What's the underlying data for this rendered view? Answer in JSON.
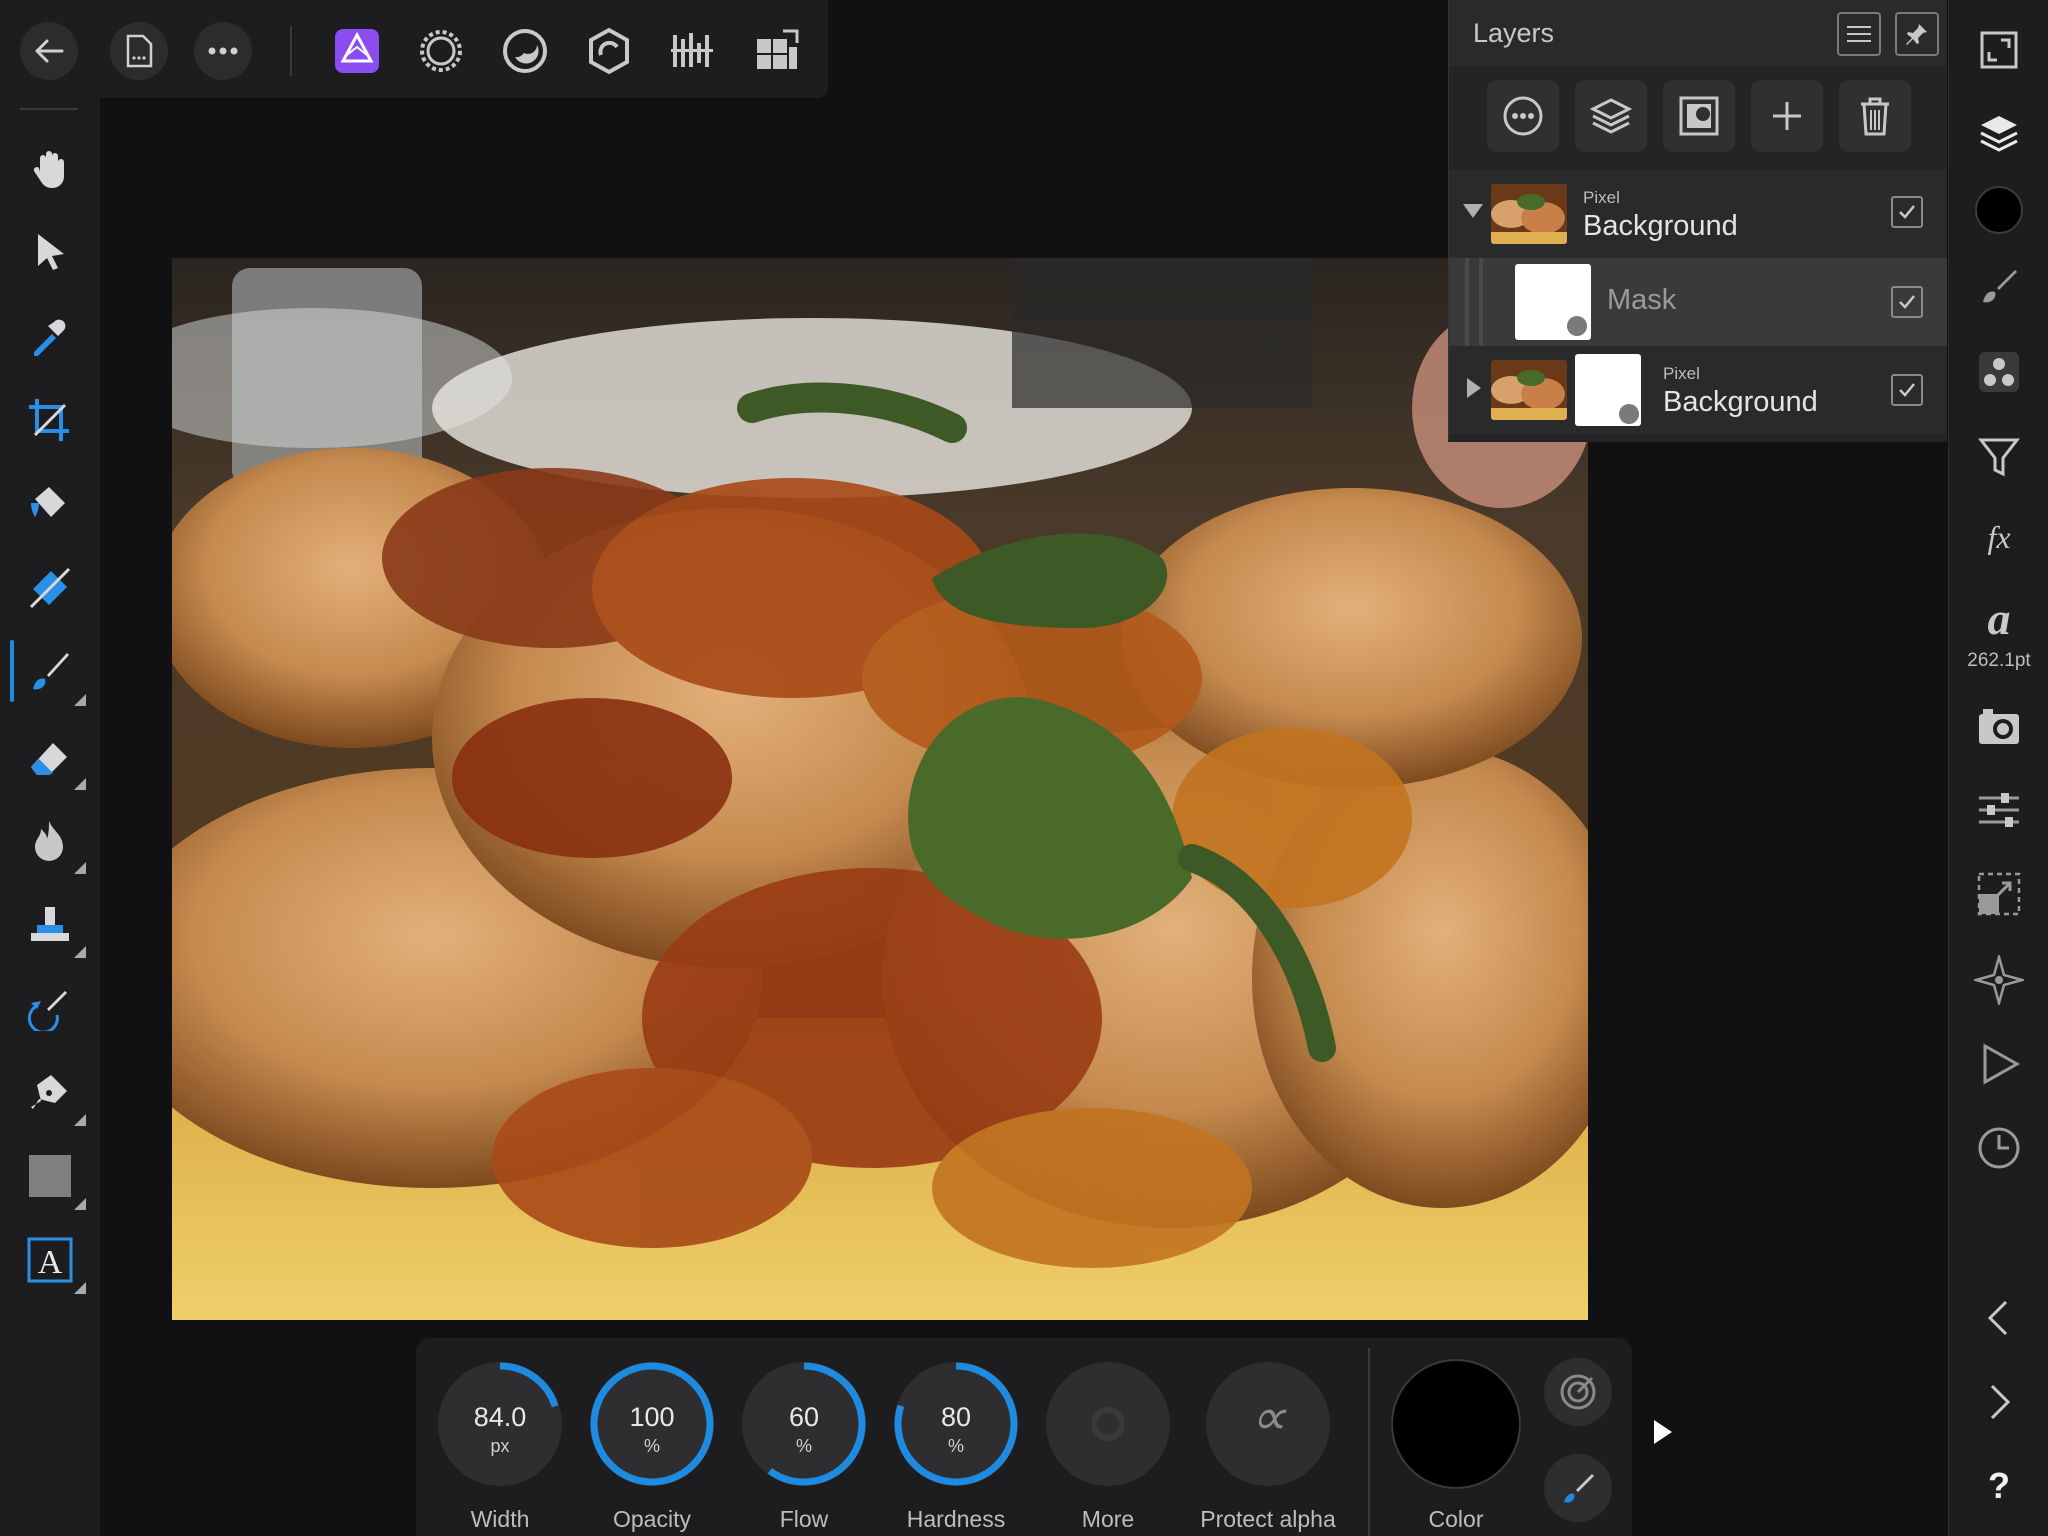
{
  "topbar": {
    "buttons": [
      "back-icon",
      "document-icon",
      "more-icon"
    ],
    "personas": [
      "photo-persona-icon",
      "liquify-persona-icon",
      "develop-persona-icon",
      "tone-mapping-persona-icon",
      "export-persona-icon",
      "slice-persona-icon"
    ],
    "accent": "#8b4cf0"
  },
  "left_tools": [
    "hand-tool",
    "move-tool",
    "color-picker-tool",
    "crop-tool",
    "flood-fill-tool",
    "gradient-tool",
    "paint-brush-tool",
    "erase-brush-tool",
    "burn-brush-tool",
    "clone-brush-tool",
    "undo-brush-tool",
    "pen-tool",
    "rectangle-tool",
    "text-tool"
  ],
  "active_tool": "paint-brush-tool",
  "layers": {
    "title": "Layers",
    "toolbar": [
      "blend-options-icon",
      "layer-stack-icon",
      "mask-icon",
      "add-layer-icon",
      "delete-layer-icon"
    ],
    "items": [
      {
        "kind": "Pixel",
        "name": "Background",
        "checked": true,
        "expanded": true
      },
      {
        "kind": "",
        "name": "Mask",
        "checked": true
      },
      {
        "kind": "Pixel",
        "name": "Background",
        "checked": true,
        "expanded": false
      }
    ]
  },
  "right_panel": {
    "studio": [
      "fullscreen-icon",
      "layers-icon",
      "color-swatch-icon",
      "brushes-icon",
      "adjustments-icon",
      "filter-icon",
      "fx-icon",
      "character-icon",
      "camera-icon",
      "sliders-icon",
      "transform-icon",
      "navigator-icon",
      "play-icon",
      "history-icon",
      "chevron-left-icon",
      "chevron-right-icon",
      "help-icon"
    ],
    "font_size": "262.1pt",
    "help": "?"
  },
  "context": {
    "width": {
      "value": "84.0",
      "unit": "px",
      "label": "Width",
      "level": 0.2
    },
    "opacity": {
      "value": "100",
      "unit": "%",
      "label": "Opacity",
      "level": 1.0
    },
    "flow": {
      "value": "60",
      "unit": "%",
      "label": "Flow",
      "level": 0.6
    },
    "hardness": {
      "value": "80",
      "unit": "%",
      "label": "Hardness",
      "level": 0.8
    },
    "more": {
      "label": "More"
    },
    "protect_alpha": {
      "label": "Protect alpha",
      "symbol": "∝"
    },
    "color": {
      "label": "Color",
      "value": "#000000"
    },
    "dial_color": "#1f8be0"
  }
}
